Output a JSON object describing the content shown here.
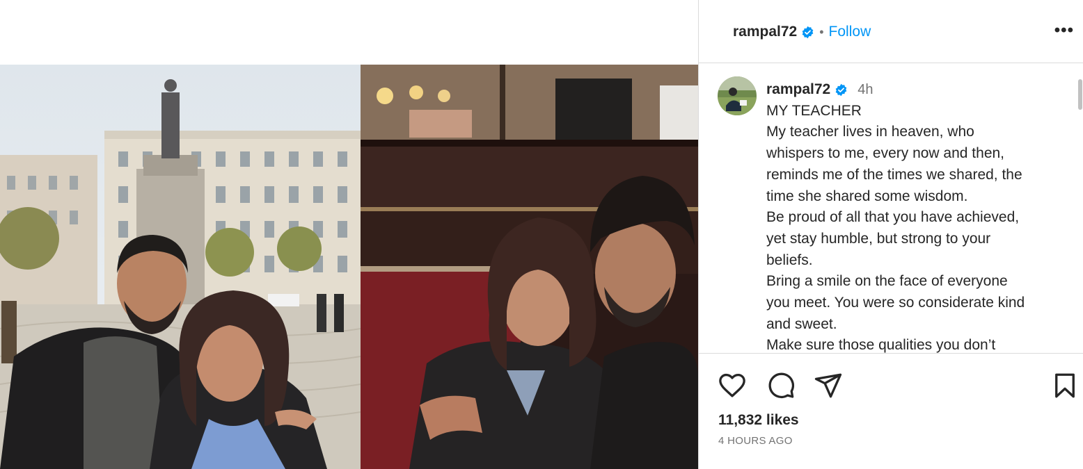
{
  "post": {
    "username": "rampal72",
    "separator": "•",
    "follow_label": "Follow",
    "more_label": "•••",
    "time_short": "4h",
    "caption_lines": [
      "MY TEACHER",
      "My teacher lives in heaven, who",
      "whispers to me, every now and then,",
      "reminds me of the times we shared, the",
      "time she shared some wisdom.",
      "Be proud of all that you have achieved,",
      "yet stay humble, but strong to your",
      "beliefs.",
      "Bring a smile on the face of everyone",
      "you meet. You were so considerate kind",
      "and sweet.",
      "Make sure those qualities you don’t"
    ],
    "likes": "11,832 likes",
    "time_ago": "4 HOURS AGO"
  },
  "icons": {
    "verified": "verified-badge-icon",
    "like": "heart-icon",
    "comment": "comment-icon",
    "share": "share-icon",
    "save": "bookmark-icon"
  },
  "colors": {
    "accent": "#0095f6",
    "text": "#262626",
    "muted": "#737373",
    "border": "#dbdbdb"
  }
}
